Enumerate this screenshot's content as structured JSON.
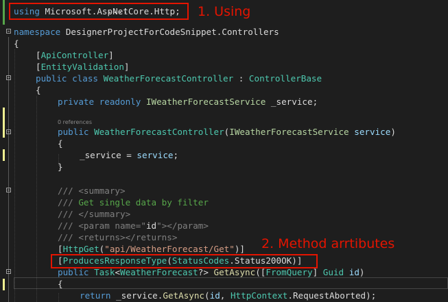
{
  "code": {
    "line_top_partial": "...;",
    "using_kw": "using",
    "using_ns": "Microsoft.AspNetCore.Http",
    "semi": ";",
    "namespace_kw": "namespace",
    "namespace_name": "DesignerProjectForCodeSnippet.Controllers",
    "brace_open": "{",
    "brace_close": "}",
    "attr_api": "ApiController",
    "attr_entity": "EntityValidation",
    "public_kw": "public",
    "class_kw": "class",
    "class_name": "WeatherForecastController",
    "colon": " : ",
    "base_class": "ControllerBase",
    "private_kw": "private",
    "readonly_kw": "readonly",
    "service_iface": "IWeatherForecastService",
    "field_name": "_service",
    "references": "0 references",
    "ctor_name": "WeatherForecastController",
    "param_service": "service",
    "assign_field": "_service",
    "assign_eq": " = ",
    "assign_value": "service",
    "xml_prefix": "/// ",
    "xml_summary_open": "<summary>",
    "xml_summary_text": "Get single data by filter",
    "xml_summary_close": "</summary>",
    "xml_param_open": "<param ",
    "xml_param_attr": "name",
    "xml_param_eq": "=\"",
    "xml_param_val": "id",
    "xml_param_close_q": "\"",
    "xml_param_end": "></param>",
    "xml_returns": "<returns></returns>",
    "http_get": "HttpGet",
    "http_get_route": "\"api/WeatherForecast/Get\"",
    "produces": "ProducesResponseType",
    "status_codes": "StatusCodes",
    "status_200": "Status200OK",
    "task_type": "Task",
    "forecast_type": "WeatherForecast",
    "nullable": "?",
    "method_name": "GetAsync",
    "from_query": "FromQuery",
    "guid_type": "Guid",
    "param_id": "id",
    "return_kw": "return",
    "call_service": "_service",
    "call_method": "GetAsync",
    "call_arg_id": "id",
    "http_context": "HttpContext",
    "request_aborted": "RequestAborted"
  },
  "annotations": {
    "using_label": "1. Using",
    "method_label": "2. Method arrtibutes"
  },
  "colors": {
    "background": "#1e1e1e",
    "keyword": "#569cd6",
    "type": "#4ec9b0",
    "interface": "#b8d7a3",
    "parameter": "#9cdcfe",
    "string": "#d69d85",
    "method": "#dcdcaa",
    "comment": "#57a64a",
    "annotation_red": "#e51400",
    "change_marker_green": "#57a64a",
    "change_marker_yellow": "#efef91"
  }
}
